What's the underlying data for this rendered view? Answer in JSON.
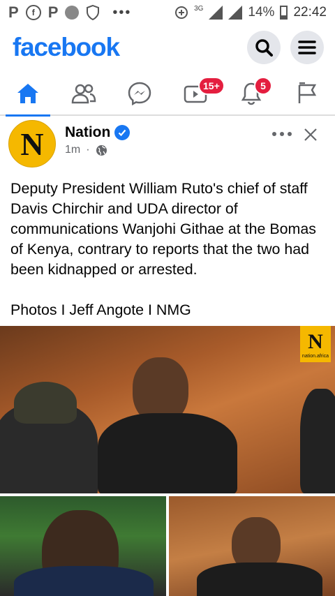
{
  "status_bar": {
    "left_icons": [
      "P",
      "facebook-icon",
      "P",
      "data-saver-icon",
      "shield-icon"
    ],
    "network": "3G",
    "battery": "14%",
    "time": "22:42"
  },
  "header": {
    "logo": "facebook"
  },
  "nav": {
    "video_badge": "15+",
    "notifications_badge": "5"
  },
  "post": {
    "page_name": "Nation",
    "time": "1m",
    "separator": "·",
    "text": "Deputy President William Ruto's chief of staff Davis Chirchir and UDA director of communications Wanjohi Githae at the Bomas of Kenya, contrary to reports that the two had been kidnapped or arrested.\n\nPhotos I Jeff Angote I NMG",
    "avatar_letter": "N",
    "watermark_letter": "N",
    "watermark_text": "nation.africa"
  },
  "colors": {
    "brand": "#1877f2",
    "badge": "#e41e3f",
    "nation_yellow": "#f5b800"
  }
}
